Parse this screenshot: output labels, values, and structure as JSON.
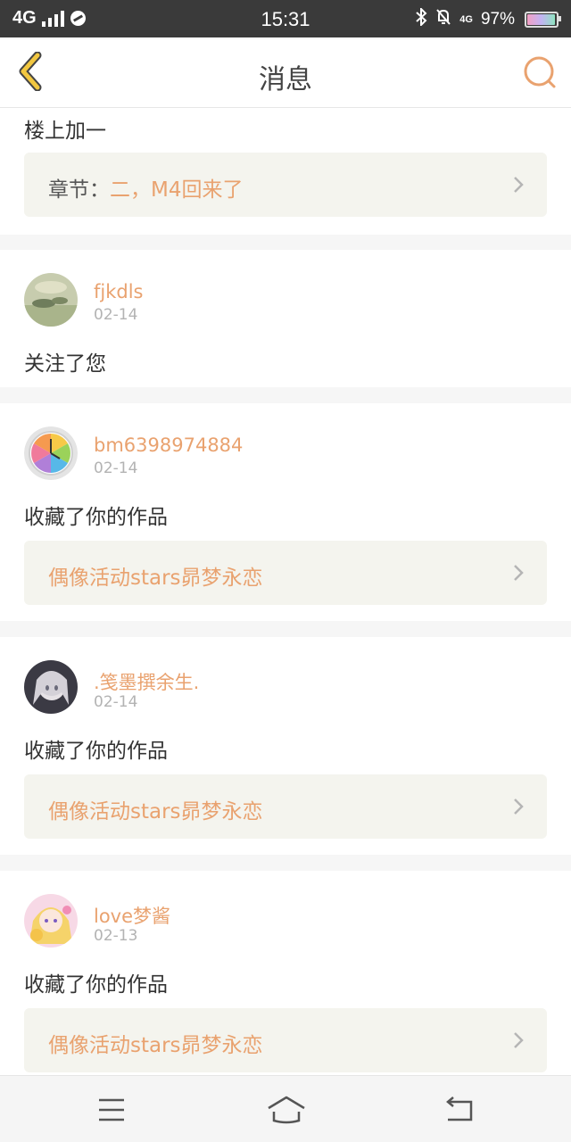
{
  "status_bar": {
    "network": "4G",
    "time": "15:31",
    "network_right": "4G",
    "battery": "97%"
  },
  "header": {
    "title": "消息",
    "back_icon": "chevron-left-icon",
    "search_icon": "search-icon"
  },
  "colors": {
    "accent": "#e9a26f",
    "back_accent": "#f2c740",
    "linkbox_bg": "#f4f4ee"
  },
  "messages": [
    {
      "action": "楼上加一",
      "link": {
        "prefix": "章节：",
        "text": "二，M4回来了"
      }
    },
    {
      "username": "fjkdls",
      "date": "02-14",
      "action": "关注了您"
    },
    {
      "username": "bm6398974884",
      "date": "02-14",
      "action": "收藏了你的作品",
      "link": {
        "prefix": "",
        "text": "偶像活动stars昴梦永恋"
      }
    },
    {
      "username": ".笺墨撰余生.",
      "date": "02-14",
      "action": "收藏了你的作品",
      "link": {
        "prefix": "",
        "text": "偶像活动stars昴梦永恋"
      }
    },
    {
      "username": "love梦酱",
      "date": "02-13",
      "action": "收藏了你的作品",
      "link": {
        "prefix": "",
        "text": "偶像活动stars昴梦永恋"
      }
    }
  ],
  "nav": {
    "menu_icon": "menu-icon",
    "home_icon": "home-icon",
    "back_icon": "back-arrow-icon"
  }
}
